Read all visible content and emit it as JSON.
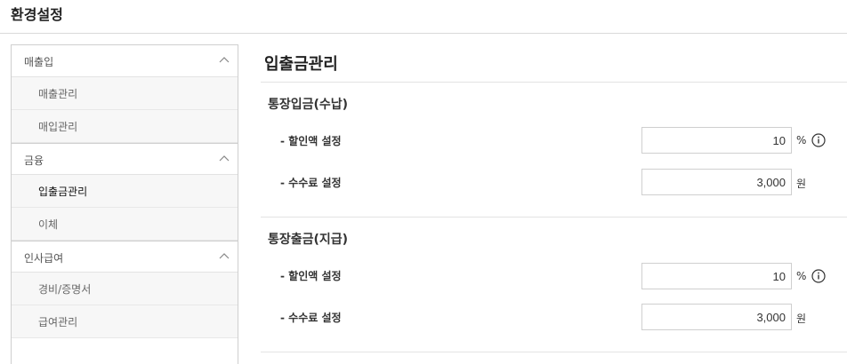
{
  "header": {
    "title": "환경설정"
  },
  "sidebar": {
    "groups": [
      {
        "label": "매출입",
        "items": [
          {
            "label": "매출관리"
          },
          {
            "label": "매입관리"
          }
        ]
      },
      {
        "label": "금융",
        "items": [
          {
            "label": "입출금관리"
          },
          {
            "label": "이체"
          }
        ]
      },
      {
        "label": "인사급여",
        "items": [
          {
            "label": "경비/증명서"
          },
          {
            "label": "급여관리"
          }
        ]
      }
    ],
    "active_item": "입출금관리"
  },
  "main": {
    "title": "입출금관리",
    "sections": [
      {
        "title": "통장입금(수납)",
        "fields": [
          {
            "label": "- 할인액 설정",
            "value": "10",
            "unit": "%",
            "info_icon": "info-icon"
          },
          {
            "label": "- 수수료 설정",
            "value": "3,000",
            "unit": "원"
          }
        ]
      },
      {
        "title": "통장출금(지급)",
        "fields": [
          {
            "label": "- 할인액 설정",
            "value": "10",
            "unit": "%",
            "info_icon": "info-icon"
          },
          {
            "label": "- 수수료 설정",
            "value": "3,000",
            "unit": "원"
          }
        ]
      }
    ]
  },
  "colors": {
    "border": "#cfcfcf",
    "subitem_bg": "#f7f7f7",
    "divider": "#e3e3e3"
  }
}
